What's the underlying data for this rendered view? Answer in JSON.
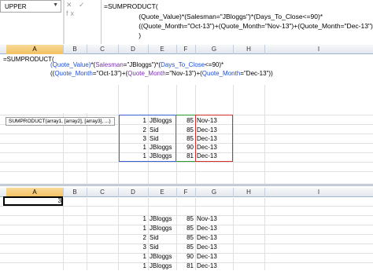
{
  "name_box": "UPPER",
  "formula_icons": "✕ ✓ fx",
  "formula_lines": [
    "=SUMPRODUCT(",
    "                    (Quote_Value)*(Salesman=\"JBloggs\")*(Days_To_Close<=90)*",
    "                    ((Quote_Month=\"Oct-13\")+(Quote_Month=\"Nov-13\")+(Quote_Month=\"Dec-13\"))",
    "                    )"
  ],
  "columns": [
    "A",
    "B",
    "C",
    "D",
    "E",
    "F",
    "G",
    "H",
    "I"
  ],
  "edit_cell": {
    "line1": "=SUMPRODUCT(",
    "line2": [
      "(Quote_Value)",
      "*(",
      "Salesman",
      "=\"JBloggs\")*(",
      "Days_To_Close",
      "<=90)*"
    ],
    "line3": [
      "((",
      "Quote_Month",
      "=\"Oct-13\")+(",
      "Quote_Month",
      "=\"Nov-13\")+(",
      "Quote_Month",
      "=\"Dec-13\"))"
    ]
  },
  "tooltip": "SUMPRODUCT(array1, [array2], [array3], ...)",
  "upper_rows": [
    {
      "num": "1",
      "name": "JBloggs",
      "val": "85",
      "month": "Nov-13"
    },
    {
      "num": "2",
      "name": "Sid",
      "val": "85",
      "month": "Dec-13"
    },
    {
      "num": "3",
      "name": "Sid",
      "val": "85",
      "month": "Dec-13"
    },
    {
      "num": "1",
      "name": "JBloggs",
      "val": "90",
      "month": "Dec-13"
    },
    {
      "num": "1",
      "name": "JBloggs",
      "val": "81",
      "month": "Dec-13"
    }
  ],
  "result_value": "3",
  "lower_rows": [
    {
      "num": "1",
      "name": "JBloggs",
      "val": "85",
      "month": "Nov-13"
    },
    {
      "num": "1",
      "name": "JBloggs",
      "val": "85",
      "month": "Dec-13"
    },
    {
      "num": "2",
      "name": "Sid",
      "val": "85",
      "month": "Dec-13"
    },
    {
      "num": "3",
      "name": "Sid",
      "val": "85",
      "month": "Dec-13"
    },
    {
      "num": "1",
      "name": "JBloggs",
      "val": "90",
      "month": "Dec-13"
    },
    {
      "num": "1",
      "name": "JBloggs",
      "val": "81",
      "month": "Dec-13"
    }
  ]
}
